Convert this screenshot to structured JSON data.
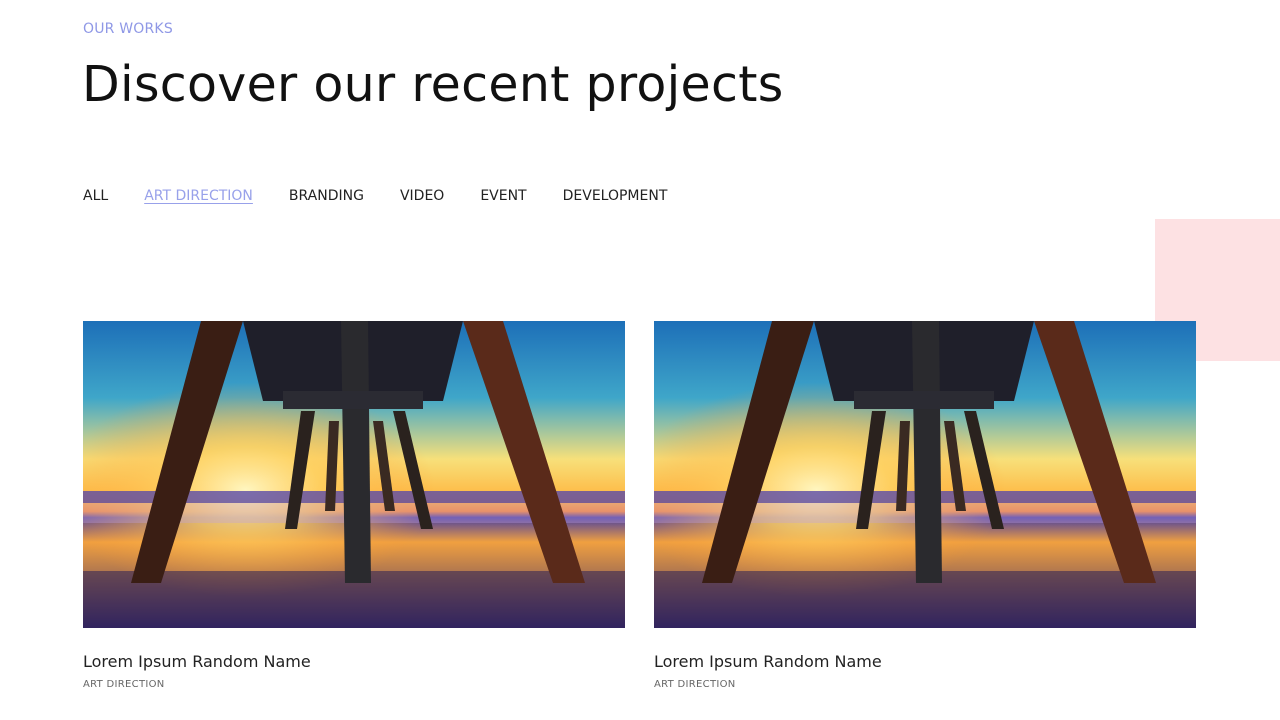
{
  "section": {
    "eyebrow": "OUR WORKS",
    "title": "Discover our recent projects"
  },
  "filters": {
    "items": [
      {
        "label": "ALL",
        "active": false
      },
      {
        "label": "ART DIRECTION",
        "active": true
      },
      {
        "label": "BRANDING",
        "active": false
      },
      {
        "label": "VIDEO",
        "active": false
      },
      {
        "label": "EVENT",
        "active": false
      },
      {
        "label": "DEVELOPMENT",
        "active": false
      }
    ]
  },
  "projects": [
    {
      "title": "Lorem Ipsum Random Name",
      "category": "ART DIRECTION",
      "image": "pier-sunset-photo"
    },
    {
      "title": "Lorem Ipsum Random Name",
      "category": "ART DIRECTION",
      "image": "pier-sunset-photo"
    }
  ],
  "colors": {
    "accent": "#98a1ea",
    "decor_pink": "#fde1e3",
    "text": "#111111"
  }
}
